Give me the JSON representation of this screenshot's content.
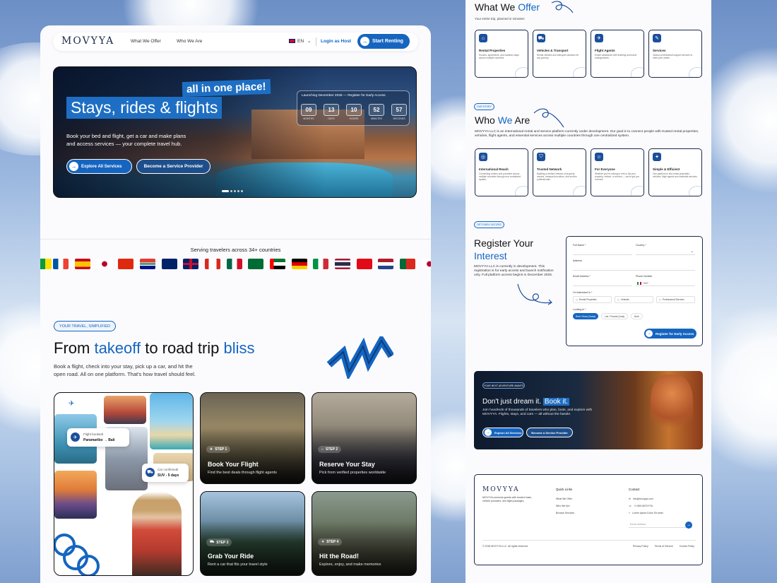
{
  "nav": {
    "logo": "MOVYYA",
    "links": [
      "What We Offer",
      "Who We Are"
    ],
    "lang": "EN",
    "login": "Login as Host",
    "cta": "Start Renting"
  },
  "hero": {
    "tag": "all in one place!",
    "title": "Stays, rides & flights",
    "desc1": "Book your bed and flight, get a car and make plans",
    "desc2": "and access services — your complete travel hub.",
    "btn1": "Explore All Services",
    "btn2": "Become a Service Provider",
    "countdown_title": "Launching December 2026 — Register for Early Access",
    "countdown": [
      {
        "v": "09",
        "l": "MONTHS"
      },
      {
        "v": "13",
        "l": "DAYS"
      },
      {
        "v": "10",
        "l": "HOURS"
      },
      {
        "v": "52",
        "l": "MINUTES"
      },
      {
        "v": "57",
        "l": "SECONDS"
      }
    ]
  },
  "flags": {
    "title": "Serving travelers across 34+ countries"
  },
  "simplified": {
    "pill": "YOUR TRAVEL, SIMPLIFIED",
    "h_pre": "From ",
    "h_a": "takeoff",
    "h_mid": " to road trip ",
    "h_b": "bliss",
    "desc1": "Book a flight, check into your stay, pick up a car, and hit the",
    "desc2": "open road. All on one platform. That's how travel should feel.",
    "note1_t": "Flight booked!",
    "note1_s": "Paramaribo → Bali",
    "note2_t": "Car confirmed!",
    "note2_s": "SUV - 5 days"
  },
  "steps": [
    {
      "step": "STEP 1",
      "title": "Book Your Flight",
      "sub": "Find the best deals through flight agents"
    },
    {
      "step": "STEP 2",
      "title": "Reserve Your Stay",
      "sub": "Pick from verified properties worldwide"
    },
    {
      "step": "STEP 3",
      "title": "Grab Your Ride",
      "sub": "Rent a car that fits your travel style"
    },
    {
      "step": "STEP 4",
      "title": "Hit the Road!",
      "sub": "Explore, enjoy, and make memories"
    }
  ],
  "offer": {
    "h_pre": "What We ",
    "h_b": "Offer",
    "sub": "Your entire trip, planned in minutes!",
    "cards": [
      {
        "t": "Rental Properties",
        "d": "Houses, apartments, and vacation stays across multiple countries."
      },
      {
        "t": "Vehicles & Transport",
        "d": "Rental vehicles and transport solutions for any journey."
      },
      {
        "t": "Flight Agents",
        "d": "Expert assistance with ticketing and travel arrangements."
      },
      {
        "t": "Services",
        "d": "Various professional support services to meet your needs."
      }
    ]
  },
  "who": {
    "pill": "OUR STORY",
    "h_pre": "Who ",
    "h_b": "We",
    "h_post": " Are",
    "desc": "MOVYYA LLC is an international rental and service platform currently under development. Our goal is to connect people with trusted rental properties, vehicles, flight agents, and essential services across multiple countries through one centralized system.",
    "cards": [
      {
        "t": "International Reach",
        "d": "Connecting renters and providers across multiple countries through one centralized system."
      },
      {
        "t": "Trusted Network",
        "d": "Building a verified network of property owners, transport providers, and service professionals."
      },
      {
        "t": "For Everyone",
        "d": "Whether you're looking to rent or list your property, vehicle, or service — we've got you covered."
      },
      {
        "t": "Simple & Efficient",
        "d": "One platform to find rental properties, vehicles, flight agents and essential services."
      }
    ]
  },
  "register": {
    "pill": "GET EARLY ACCESS",
    "h1": "Register Your",
    "h2": "Interest",
    "desc": "MOVYYA LLC is currently in development. This registration is for early access and launch notification only. Full platform access begins in December 2026.",
    "labels": {
      "name": "Full Name *",
      "country": "Country *",
      "address": "Address",
      "email": "Email Address *",
      "phone": "Phone Number",
      "code": "+597",
      "interest": "I'm Interested In *",
      "looking": "Looking to *"
    },
    "opts": [
      "Rental Properties",
      "Vehicles",
      "Professional Services"
    ],
    "looking": [
      "Rent / Book (Guest)",
      "List / Provide (Host)",
      "Both"
    ],
    "submit": "Register for Early Access"
  },
  "banner": {
    "pill": "YOUR NEXT ADVENTURE AWAITS",
    "h_pre": "Don't just dream it. ",
    "h_b": "Book it.",
    "desc": "Join hundreds of thousands of travelers who plan, book, and explore with MOVYYA. Flights, stays, and cars — all without the hassle.",
    "btn1": "Explore All Services",
    "btn2": "Become a Service Provider"
  },
  "footer": {
    "logo": "MOVYYA",
    "about": "MOVYYA connects guests with trusted hosts, vehicle providers, and flight packages.",
    "quick_title": "Quick Links",
    "quick": [
      "What We Offer",
      "Who We Are",
      "Browse Services"
    ],
    "contact_title": "Contact",
    "contact": [
      "info@movyya.com",
      "+1 800-MOVYYA",
      "Lorem Ipsum Dolor Sit amet"
    ],
    "email_placeholder": "Email address",
    "copy": "© 2026 MOVYYA LLC. All rights reserved.",
    "legal": [
      "Privacy Policy",
      "Terms of Service",
      "Cookie Policy"
    ]
  },
  "colors": {
    "accent": "#1565c0",
    "dark": "#1b2a4a"
  }
}
